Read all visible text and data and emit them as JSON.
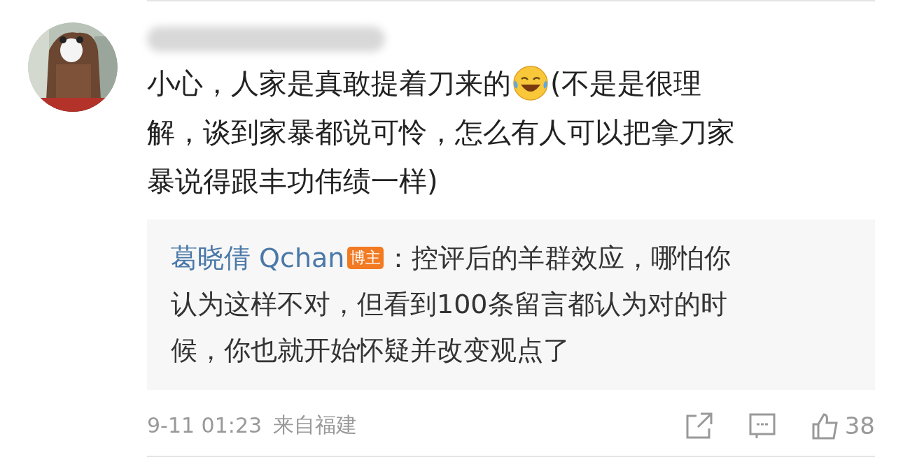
{
  "comment": {
    "text_before_emoji": "小心，人家是真敢提着刀来的",
    "text_after_emoji": "(不是是很理",
    "text_more_lines": [
      "解，谈到家暴都说可怜，怎么有人可以把拿刀家",
      "暴说得跟丰功伟绩一样)"
    ],
    "reply": {
      "author": "葛晓倩 Qchan",
      "badge": "博主",
      "first_line": "：控评后的羊群效应，哪怕你",
      "more_lines": [
        "认为这样不对，但看到100条留言都认为对的时",
        "候，你也就开始怀疑并改变观点了"
      ]
    },
    "time": "9-11 01:23",
    "location": "来自福建",
    "likes": "38"
  }
}
